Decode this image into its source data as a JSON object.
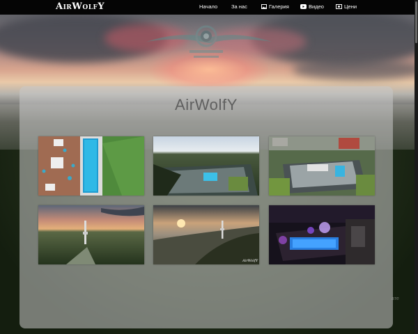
{
  "brand": {
    "name": "AirWolfY"
  },
  "nav": {
    "items": [
      {
        "label": "Начало",
        "icon": ""
      },
      {
        "label": "За нас",
        "icon": ""
      },
      {
        "label": "Галерия",
        "icon": "image-icon"
      },
      {
        "label": "Видео",
        "icon": "youtube-icon"
      },
      {
        "label": "Цени",
        "icon": "money-icon"
      }
    ]
  },
  "gallery": {
    "title": "AirWolfY",
    "photos": [
      {
        "subject": "rooftop-pool-party"
      },
      {
        "subject": "rooftop-pool-panorama"
      },
      {
        "subject": "city-rooftop-pool"
      },
      {
        "subject": "tv-tower-sunset"
      },
      {
        "subject": "tv-tower-misty-sunrise",
        "caption": "AirWolfY"
      },
      {
        "subject": "night-rooftop-party"
      }
    ]
  },
  "ghost_text": "ате",
  "colors": {
    "nav_bg": "#050505",
    "panel": "rgba(200,200,200,0.55)",
    "title": "#5f5f5f"
  }
}
